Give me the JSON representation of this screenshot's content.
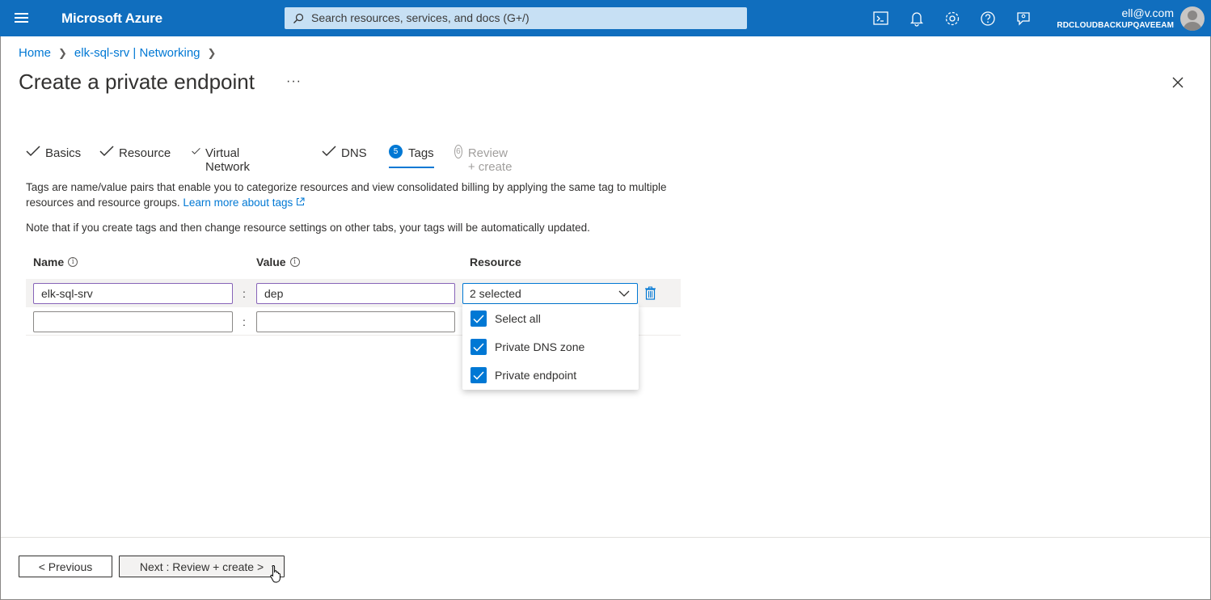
{
  "topbar": {
    "brand": "Microsoft Azure",
    "search_placeholder": "Search resources, services, and docs (G+/)",
    "user_email": "ell@v.com",
    "user_tenant": "RDCLOUDBACKUPQAVEEAM",
    "icons": [
      "cloud-shell-icon",
      "notifications-icon",
      "settings-icon",
      "help-icon",
      "feedback-icon"
    ]
  },
  "breadcrumb": {
    "items": [
      "Home",
      "elk-sql-srv | Networking"
    ]
  },
  "page": {
    "title": "Create a private endpoint",
    "more": "···"
  },
  "tabs": [
    {
      "label": "Basics",
      "state": "done"
    },
    {
      "label": "Resource",
      "state": "done"
    },
    {
      "label": "Virtual Network",
      "state": "done"
    },
    {
      "label": "DNS",
      "state": "done"
    },
    {
      "label": "Tags",
      "state": "active",
      "step": "5"
    },
    {
      "label": "Review + create",
      "state": "disabled",
      "step": "6"
    }
  ],
  "description": {
    "text": "Tags are name/value pairs that enable you to categorize resources and view consolidated billing by applying the same tag to multiple resources and resource groups.",
    "link": "Learn more about tags",
    "note": "Note that if you create tags and then change resource settings on other tabs, your tags will be automatically updated."
  },
  "table": {
    "headers": {
      "name": "Name",
      "value": "Value",
      "resource": "Resource"
    },
    "rows": [
      {
        "name": "elk-sql-srv",
        "value": "dep",
        "resource": "2 selected"
      },
      {
        "name": "",
        "value": "",
        "resource": ""
      }
    ],
    "separator": ":"
  },
  "dropdown_menu": {
    "options": [
      {
        "label": "Select all",
        "checked": true
      },
      {
        "label": "Private DNS zone",
        "checked": true
      },
      {
        "label": "Private endpoint",
        "checked": true
      }
    ]
  },
  "footer": {
    "previous": "< Previous",
    "next": "Next : Review + create >"
  },
  "colors": {
    "topbar": "#106ebe",
    "accent": "#0078d4",
    "filled_border": "#8764b8"
  }
}
